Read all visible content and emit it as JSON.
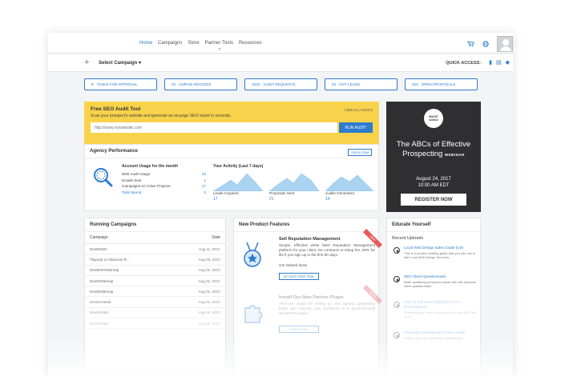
{
  "nav": {
    "links": [
      "Home",
      "Campaigns",
      "Store",
      "Partner Tools",
      "Resources"
    ],
    "icons": [
      "cart-icon",
      "globe-icon"
    ]
  },
  "subbar": {
    "select_campaign": "Select Campaign",
    "quick_access": "QUICK ACCESS:"
  },
  "stats": [
    {
      "count": "9",
      "label": "TASKS FOR APPROVAL"
    },
    {
      "count": "24",
      "label": "UNPAID INVOICES"
    },
    {
      "count": "1923",
      "label": "AUDIT REQUESTS"
    },
    {
      "count": "53",
      "label": "HOT LEADS"
    },
    {
      "count": "103",
      "label": "OPEN PROPOSALS"
    }
  ],
  "seo_tool": {
    "title": "Free SEO Audit Tool",
    "subtitle": "Scan your prospect's website and generate an on-page SEO report in seconds.",
    "view_all": "VIEW ALL AUDITS",
    "placeholder": "http://www.mywebsite.com",
    "button": "RUN AUDIT"
  },
  "performance": {
    "title": "Agency Performance",
    "open_crm": "OPEN CRM",
    "usage_title": "Account Usage for the month",
    "usage": [
      {
        "label": "Web Audit Usage",
        "value": "23"
      },
      {
        "label": "Emails Sent",
        "value": "1"
      },
      {
        "label": "Campaigns w/ Active Projects",
        "value": "17"
      },
      {
        "label": "Total Spend",
        "value": "0"
      }
    ],
    "activity_title": "Your Activity (Last 7 days)",
    "activity": [
      {
        "label": "Leads Acquired",
        "value": "17"
      },
      {
        "label": "Proposals Sent",
        "value": "21"
      },
      {
        "label": "Audits Generated",
        "value": "14"
      }
    ]
  },
  "ad": {
    "logo_line1": "BOOST",
    "logo_line2": "science",
    "title_line1": "The ABCs of Effective",
    "title_line2": "Prospecting",
    "webinar": "WEBINAR",
    "date": "August 24, 2017",
    "time": "10:00 AM EDT",
    "button": "REGISTER NOW"
  },
  "running": {
    "title": "Running Campaigns",
    "col_campaign": "Campaign",
    "col_date": "Date",
    "rows": [
      {
        "name": "DevMGDC",
        "date": "Aug 11, 2017"
      },
      {
        "name": "Tlayuda LA Mexican R...",
        "date": "Aug 03, 2017"
      },
      {
        "name": "DevWOHSitemap",
        "date": "Aug 01, 2017"
      },
      {
        "name": "DevWSitemap",
        "date": "Aug 01, 2017"
      },
      {
        "name": "DevWSitemap",
        "date": "Aug 01, 2017"
      },
      {
        "name": "DevDentalab",
        "date": "Aug 01, 2017"
      },
      {
        "name": "DevDentals",
        "date": "Aug 01, 2017"
      },
      {
        "name": "DevDentals",
        "date": "Aug 01, 2017"
      }
    ]
  },
  "products": {
    "title": "New Product Features",
    "items": [
      {
        "ribbon": "NEW",
        "title": "Sell Reputation Management",
        "desc": "Simple, effective white label Reputation Management platform for your client. No contracts or setup fee. 50% for life if you sign up in the first 90 days.",
        "extra": "Get Started Now!",
        "button": "ACTIVATE FREE TRIAL"
      },
      {
        "ribbon": "NEW",
        "title": "Install Our New Partner Plugin",
        "desc": "All-in-one plugin for setting up your agency, generating leads and tracking your prospects in a quick-to-install WordPress plugin.",
        "button": "LEARN MORE"
      }
    ]
  },
  "educate": {
    "title": "Educate Yourself",
    "recent": "Recent Uploads",
    "items": [
      {
        "title": "Local Web Design Sales Guide (US)",
        "desc": "This is a product briefing guide that you can use to sell Local Web Design Services."
      },
      {
        "title": "SEO Client Questionnaire",
        "desc": "Make qualifying prospects easier with this advance client questionnaire."
      },
      {
        "title": "How To Sell Local SEO Like a Pro (Presentation)",
        "desc": "Everything you need to know to sell Local SEO like a pro."
      },
      {
        "title": "Reputation Management Sales Guide",
        "desc": "A sales guide for reputation management."
      }
    ]
  },
  "colors": {
    "accent": "#2b7bd0",
    "seo_bg": "#f8d24a",
    "ad_bg": "#2f2f31",
    "ribbon": "#e85a5a"
  }
}
